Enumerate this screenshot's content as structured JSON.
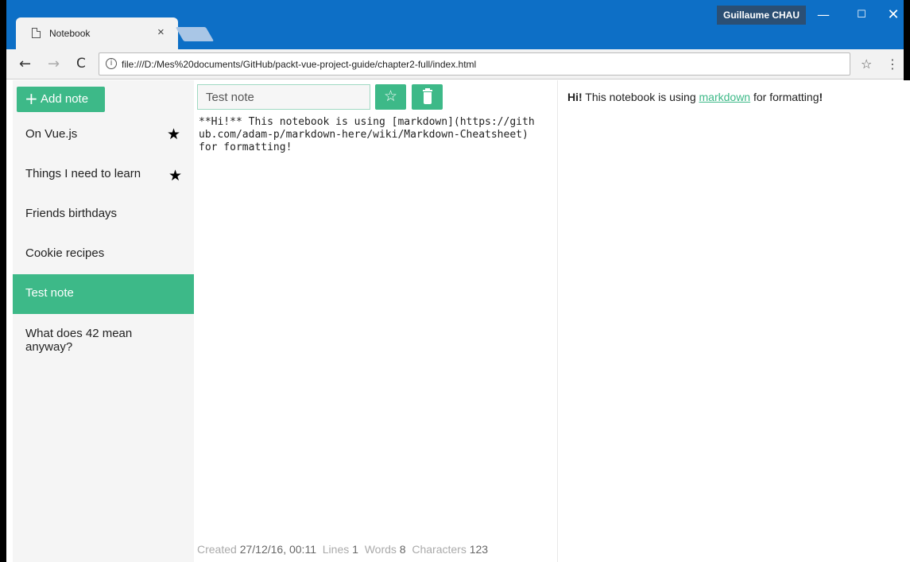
{
  "window": {
    "user": "Guillaume CHAU",
    "minimize": "—",
    "maximize": "☐",
    "close": "✕"
  },
  "tab": {
    "title": "Notebook",
    "close": "×"
  },
  "toolbar": {
    "back": "←",
    "forward": "→",
    "reload": "C",
    "info": "i",
    "url": "file:///D:/Mes%20documents/GitHub/packt-vue-project-guide/chapter2-full/index.html",
    "bookmark": "☆",
    "menu": "⋮"
  },
  "sidebar": {
    "add_plus": "+",
    "add_label": "Add note",
    "notes": [
      {
        "title": "On Vue.js",
        "favorite": true
      },
      {
        "title": "Things I need to learn",
        "favorite": true
      },
      {
        "title": "Friends birthdays",
        "favorite": false
      },
      {
        "title": "Cookie recipes",
        "favorite": false
      },
      {
        "title": "Test note",
        "favorite": false,
        "selected": true
      },
      {
        "title": "What does 42 mean anyway?",
        "favorite": false
      }
    ],
    "star": "★"
  },
  "editor": {
    "title_value": "Test note",
    "fav_star": "☆",
    "content": "**Hi!** This notebook is using [markdown](https://github.com/adam-p/markdown-here/wiki/Markdown-Cheatsheet) for formatting!",
    "stats": {
      "created_label": "Created",
      "created_value": "27/12/16, 00:11",
      "lines_label": "Lines",
      "lines_value": "1",
      "words_label": "Words",
      "words_value": "8",
      "chars_label": "Characters",
      "chars_value": "123"
    }
  },
  "preview": {
    "bold": "Hi!",
    "text1": " This notebook is using ",
    "link": "markdown",
    "text2": " for formatting",
    "bang": "!"
  },
  "colors": {
    "accent": "#3db988",
    "titlebar": "#0d6fc6"
  }
}
